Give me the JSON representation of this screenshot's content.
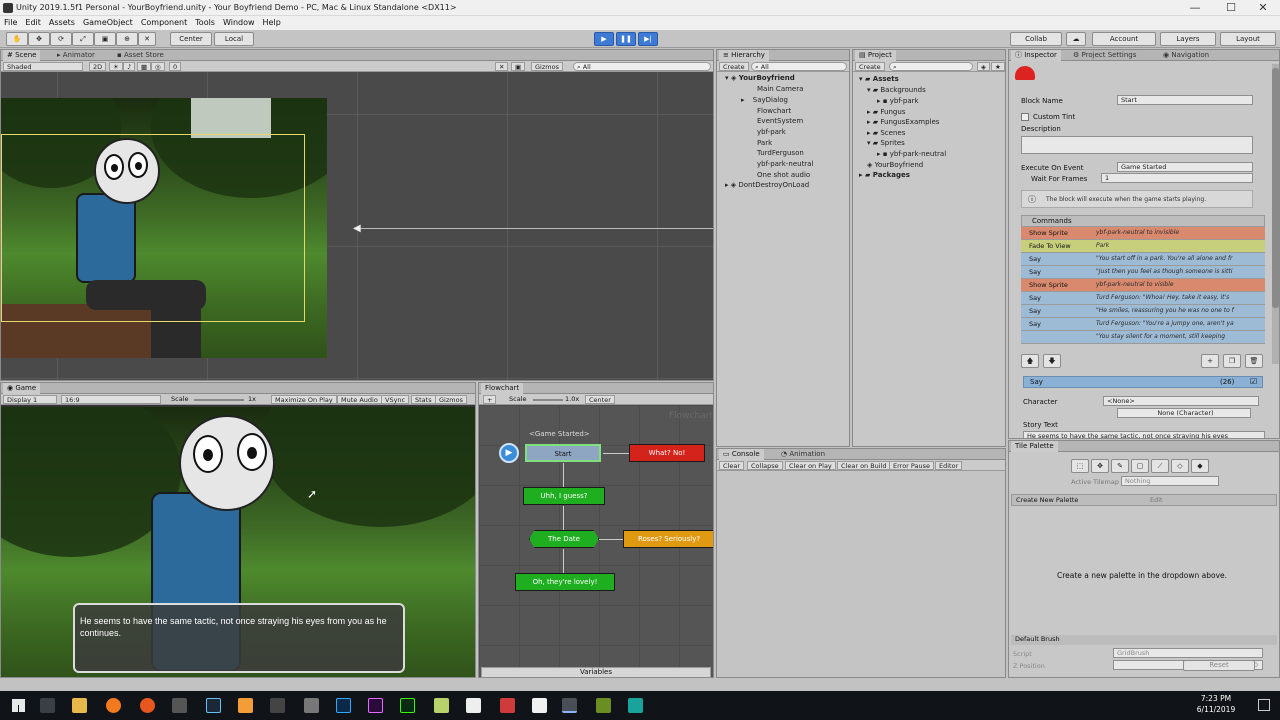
{
  "titlebar": {
    "title": "Unity 2019.1.5f1 Personal - YourBoyfriend.unity - Your Boyfriend Demo - PC, Mac & Linux Standalone <DX11>",
    "minimize": "—",
    "maximize": "☐",
    "close": "✕"
  },
  "menu": [
    "File",
    "Edit",
    "Assets",
    "GameObject",
    "Component",
    "Tools",
    "Window",
    "Help"
  ],
  "toolbar": {
    "center": "Center",
    "local": "Local",
    "collab": "Collab",
    "account": "Account",
    "layers": "Layers",
    "layout": "Layout"
  },
  "scene": {
    "tabs": [
      "Scene",
      "Animator",
      "Asset Store"
    ],
    "shading": "Shaded",
    "mode2d": "2D",
    "gizmos": "Gizmos",
    "search": "All",
    "effects_count": "0"
  },
  "game": {
    "tab": "Game",
    "display": "Display 1",
    "aspect": "16:9",
    "scale_label": "Scale",
    "scale_value": "1x",
    "buttons": [
      "Maximize On Play",
      "Mute Audio",
      "VSync",
      "Stats",
      "Gizmos"
    ],
    "dialog_text": "He seems to have the same tactic, not once straying his eyes from you as he continues."
  },
  "flowchart": {
    "tab": "Flowchart",
    "add": "+",
    "scale_label": "Scale",
    "scale_value": "1.0x",
    "center": "Center",
    "watermark": "Flowchart",
    "event_label": "<Game Started>",
    "nodes": {
      "start": "Start",
      "what_no": "What? No!",
      "uhh": "Uhh, I guess?",
      "date": "The Date",
      "roses": "Roses? Seriously?",
      "lovely": "Oh, they're lovely!"
    },
    "variables": "Variables"
  },
  "hierarchy": {
    "tab": "Hierarchy",
    "create": "Create",
    "search": "All",
    "scene": "YourBoyfriend",
    "items": [
      "Main Camera",
      "SayDialog",
      "Flowchart",
      "EventSystem",
      "ybf-park",
      "Park",
      "TurdFerguson",
      "ybf-park-neutral",
      "One shot audio"
    ],
    "dontdestroy": "DontDestroyOnLoad"
  },
  "project": {
    "tab": "Project",
    "create": "Create",
    "items": [
      {
        "label": "Assets",
        "bold": true
      },
      {
        "label": "Backgrounds",
        "bold": false
      },
      {
        "label": "ybf-park",
        "bold": false
      },
      {
        "label": "Fungus",
        "bold": false
      },
      {
        "label": "FungusExamples",
        "bold": false
      },
      {
        "label": "Scenes",
        "bold": false
      },
      {
        "label": "Sprites",
        "bold": false
      },
      {
        "label": "ybf-park-neutral",
        "bold": false
      },
      {
        "label": "YourBoyfriend",
        "bold": false
      },
      {
        "label": "Packages",
        "bold": true
      }
    ]
  },
  "inspector": {
    "tabs": [
      "Inspector",
      "Project Settings",
      "Navigation"
    ],
    "block_name_label": "Block Name",
    "block_name": "Start",
    "custom_tint": "Custom Tint",
    "description": "Description",
    "execute_label": "Execute On Event",
    "execute_value": "Game Started",
    "wait_label": "Wait For Frames",
    "wait_value": "1",
    "info": "The block will execute when the game starts playing.",
    "commands_header": "Commands",
    "commands": [
      {
        "name": "Show Sprite",
        "desc": "ybf-park-neutral to invisible",
        "color": "#d98a6e"
      },
      {
        "name": "Fade To View",
        "desc": "Park",
        "color": "#c7cf7d"
      },
      {
        "name": "Say",
        "desc": "\"You start off in a park. You're all alone and fr",
        "color": "#9ebbd6"
      },
      {
        "name": "Say",
        "desc": "\"Just then you feel as though someone is sitti",
        "color": "#9ebbd6"
      },
      {
        "name": "Show Sprite",
        "desc": "ybf-park-neutral to visible",
        "color": "#d98a6e"
      },
      {
        "name": "Say",
        "desc": "Turd Ferguson: \"Whoa! Hey, take it easy, it's",
        "color": "#9ebbd6"
      },
      {
        "name": "Say",
        "desc": "\"He smiles, reassuring you he was no one to f",
        "color": "#9ebbd6"
      },
      {
        "name": "Say",
        "desc": "Turd Ferguson: \"You're a jumpy one, aren't ya",
        "color": "#9ebbd6"
      },
      {
        "name": "",
        "desc": "\"You stay silent for a moment, still keeping",
        "color": "#9ebbd6"
      }
    ],
    "selected_cmd": "Say",
    "selected_idx": "(26)",
    "character_label": "Character",
    "character_value": "<None>",
    "character_none": "None (Character)",
    "story_label": "Story Text",
    "story_value": "He seems to have the same tactic, not once straying his eyes"
  },
  "tile_palette": {
    "tab": "Tile Palette",
    "active_tilemap_label": "Active Tilemap",
    "active_tilemap": "Nothing",
    "create_palette": "Create New Palette",
    "edit": "Edit",
    "empty_msg": "Create a new palette in the dropdown above.",
    "brush": "Default Brush",
    "script_label": "Script",
    "script_value": "GridBrush",
    "zpos_label": "Z Position",
    "zpos_value": "0",
    "reset": "Reset"
  },
  "console": {
    "tabs": [
      "Console",
      "Animation"
    ],
    "buttons": [
      "Clear",
      "Collapse",
      "Clear on Play",
      "Clear on Build",
      "Error Pause",
      "Editor"
    ]
  },
  "taskbar": {
    "time": "7:23 PM",
    "date": "6/11/2019"
  }
}
